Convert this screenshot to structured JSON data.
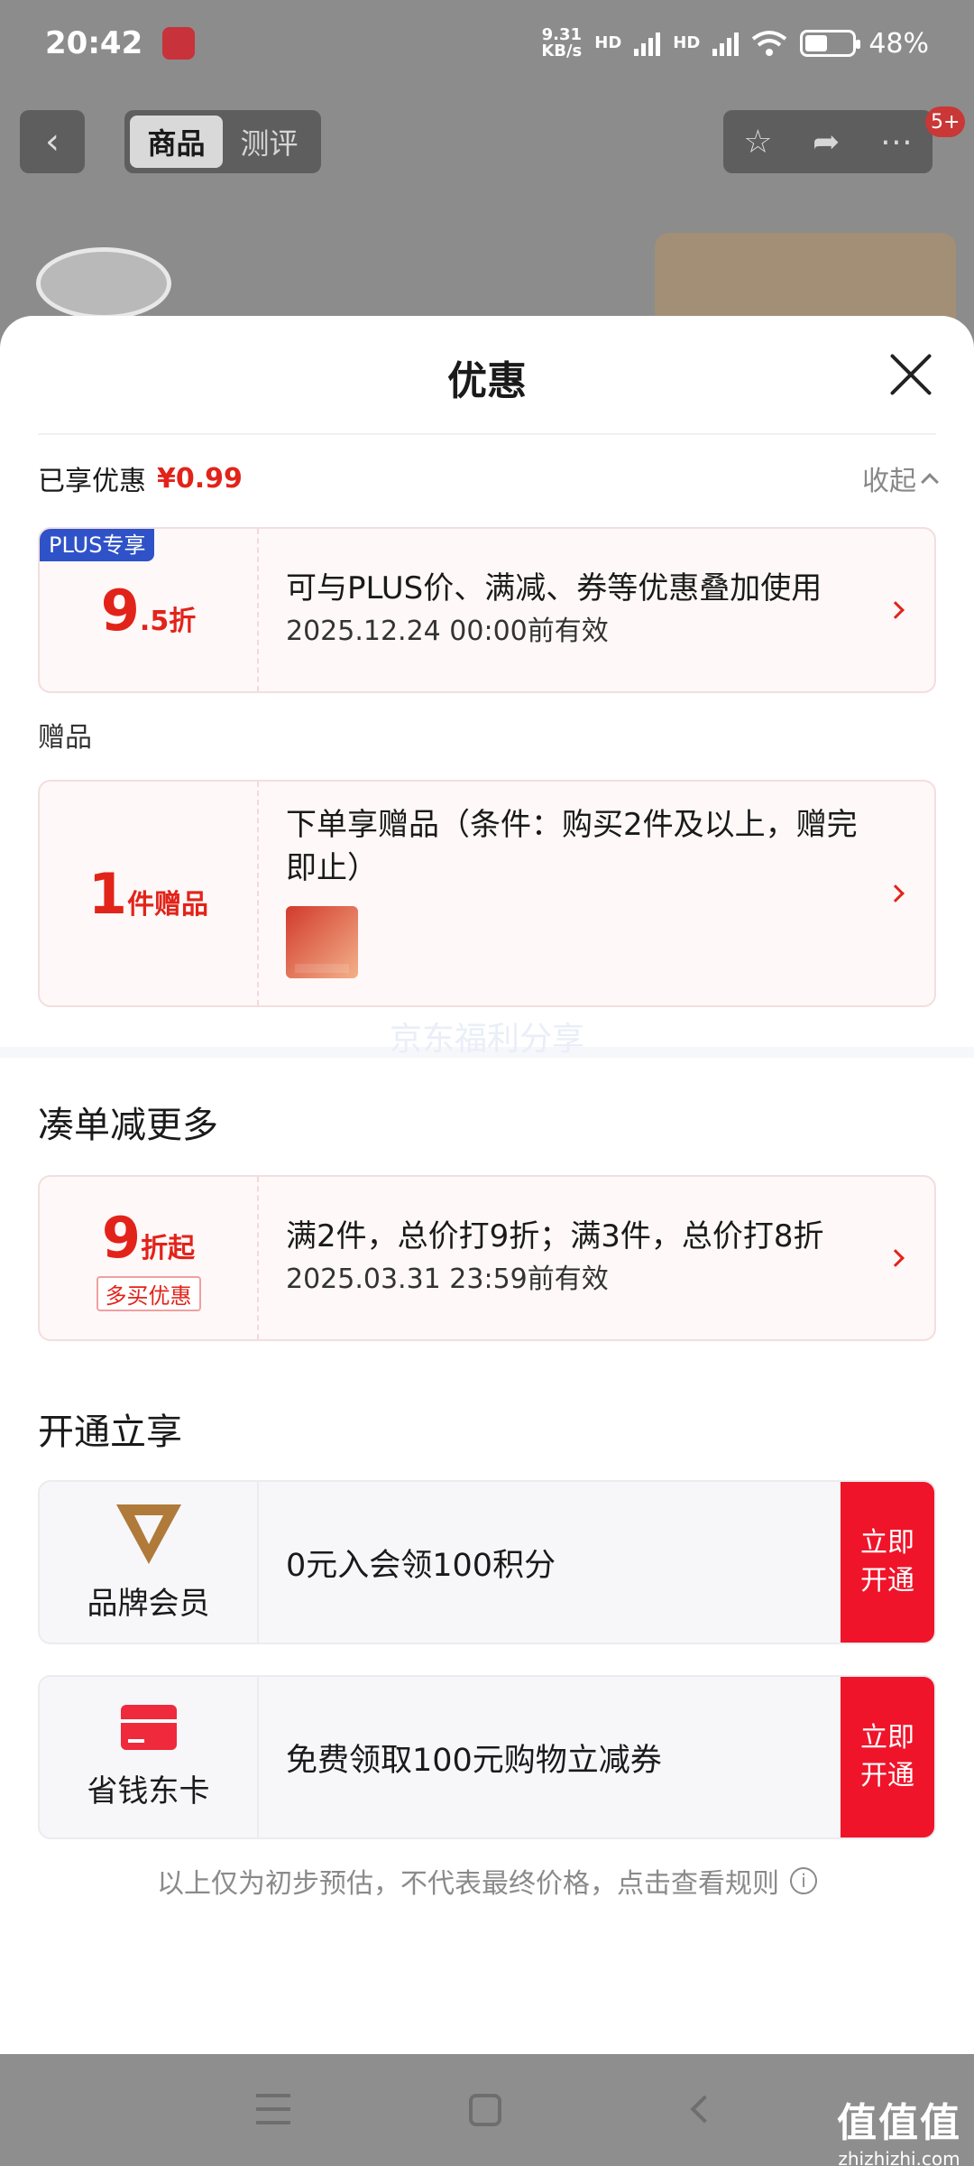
{
  "status_bar": {
    "time": "20:42",
    "net_speed_value": "9.31",
    "net_speed_unit": "KB/s",
    "hd1": "HD",
    "hd2": "HD",
    "battery": "48%"
  },
  "nav": {
    "tabs": [
      {
        "label": "商品"
      },
      {
        "label": "测评"
      }
    ],
    "badge": "5+"
  },
  "sheet": {
    "title": "优惠",
    "enjoyed_label": "已享优惠",
    "enjoyed_amount": "¥0.99",
    "collapse_label": "收起",
    "plus_card": {
      "tag": "PLUS专享",
      "value_main": "9",
      "value_unit": ".5折",
      "desc": "可与PLUS价、满减、券等优惠叠加使用",
      "valid": "2025.12.24 00:00前有效"
    },
    "gift_section_label": "赠品",
    "gift_card": {
      "value_main": "1",
      "value_unit": "件赠品",
      "desc": "下单享赠品（条件：购买2件及以上，赠完即止）"
    },
    "watermark": "京东福利分享",
    "bundle_heading": "凑单减更多",
    "bundle_card": {
      "value_main": "9",
      "value_unit": "折起",
      "tag": "多买优惠",
      "desc": "满2件，总价打9折；满3件，总价打8折",
      "valid": "2025.03.31 23:59前有效"
    },
    "member_heading": "开通立享",
    "members": [
      {
        "name": "品牌会员",
        "desc": "0元入会领100积分",
        "button": "立即开通"
      },
      {
        "name": "省钱东卡",
        "desc": "免费领取100元购物立减券",
        "button": "立即开通"
      }
    ],
    "disclaimer": "以上仅为初步预估，不代表最终价格，点击查看规则"
  },
  "watermark_brand": {
    "line1": "值值值",
    "line2": "zhizhizhi.com"
  },
  "colors": {
    "accent_red": "#e2231a",
    "plus_blue": "#2f52c8",
    "button_red": "#f0142a"
  }
}
